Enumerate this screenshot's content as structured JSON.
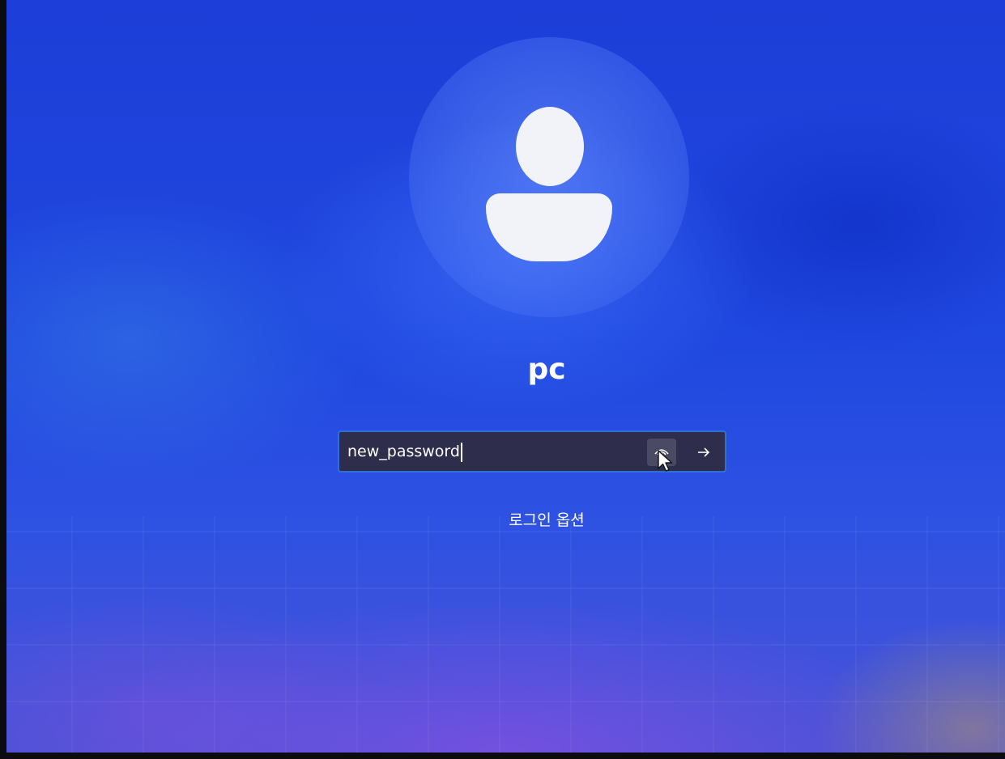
{
  "lock_screen": {
    "username": "pc",
    "password_field": {
      "value": "new_password"
    },
    "signin_options_label": "로그인 옵션"
  },
  "icons": {
    "avatar": "user-silhouette-icon",
    "reveal": "eye-reveal-icon",
    "submit": "arrow-right-icon",
    "pointer": "mouse-pointer-icon"
  },
  "colors": {
    "background": "#1a3fd6",
    "input_background": "#2e2d4c",
    "input_border": "#2f6fd6",
    "text": "#ffffff"
  }
}
